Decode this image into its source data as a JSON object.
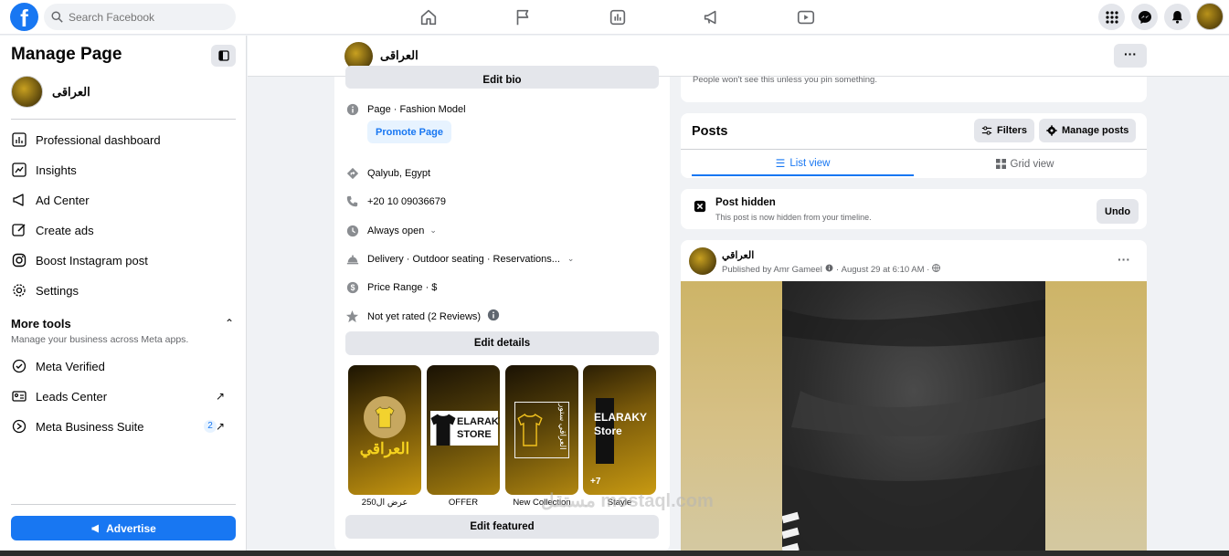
{
  "topbar": {
    "logo": "f",
    "search_placeholder": "Search Facebook",
    "nav_icons": [
      "home-icon",
      "flag-icon",
      "insights-icon",
      "megaphone-icon",
      "video-icon"
    ],
    "right_icons": [
      "menu-grid-icon",
      "messenger-icon",
      "bell-icon"
    ]
  },
  "sidebar": {
    "title": "Manage Page",
    "page_name": "العراقى",
    "items": [
      {
        "label": "Professional dashboard",
        "icon": "dashboard-icon"
      },
      {
        "label": "Insights",
        "icon": "insights-icon"
      },
      {
        "label": "Ad Center",
        "icon": "megaphone-icon"
      },
      {
        "label": "Create ads",
        "icon": "pencil-icon"
      },
      {
        "label": "Boost Instagram post",
        "icon": "instagram-icon"
      },
      {
        "label": "Settings",
        "icon": "gear-icon"
      }
    ],
    "more_tools_title": "More tools",
    "more_tools_sub": "Manage your business across Meta apps.",
    "tools": [
      {
        "label": "Meta Verified",
        "icon": "verified-icon"
      },
      {
        "label": "Leads Center",
        "icon": "leads-icon"
      },
      {
        "label": "Meta Business Suite",
        "icon": "business-suite-icon",
        "badge": "2"
      }
    ],
    "advertise_label": "Advertise"
  },
  "header": {
    "page_name": "العراقى",
    "more": "···"
  },
  "intro": {
    "edit_bio": "Edit bio",
    "category": "Page · Fashion Model",
    "promote": "Promote Page",
    "location": "Qalyub, Egypt",
    "phone": "+20 10 09036679",
    "hours": "Always open",
    "services": "Delivery · Outdoor seating · Reservations...",
    "price": "Price Range · $",
    "rating": "Not yet rated (2 Reviews)",
    "edit_details": "Edit details",
    "featured": [
      {
        "label": "عرض ال250",
        "art": "العراقي"
      },
      {
        "label": "OFFER",
        "art": "ELARAKY STORE"
      },
      {
        "label": "New Collection",
        "art": "العراقي ستور"
      },
      {
        "label": "Stayle",
        "art": "ELARAKY Store",
        "more": "+7"
      }
    ],
    "edit_featured": "Edit featured"
  },
  "pinned": {
    "note": "People won't see this unless you pin something."
  },
  "posts": {
    "title": "Posts",
    "filters": "Filters",
    "manage": "Manage posts",
    "tab_list": "List view",
    "tab_grid": "Grid view"
  },
  "hidden": {
    "title": "Post hidden",
    "sub": "This post is now hidden from your timeline.",
    "undo": "Undo"
  },
  "post": {
    "author": "العراقي",
    "published_by": "Published by Amr Gameel",
    "date": "August 29 at 6:10 AM",
    "more": "···"
  },
  "watermark": "مستقل mostaql.com"
}
